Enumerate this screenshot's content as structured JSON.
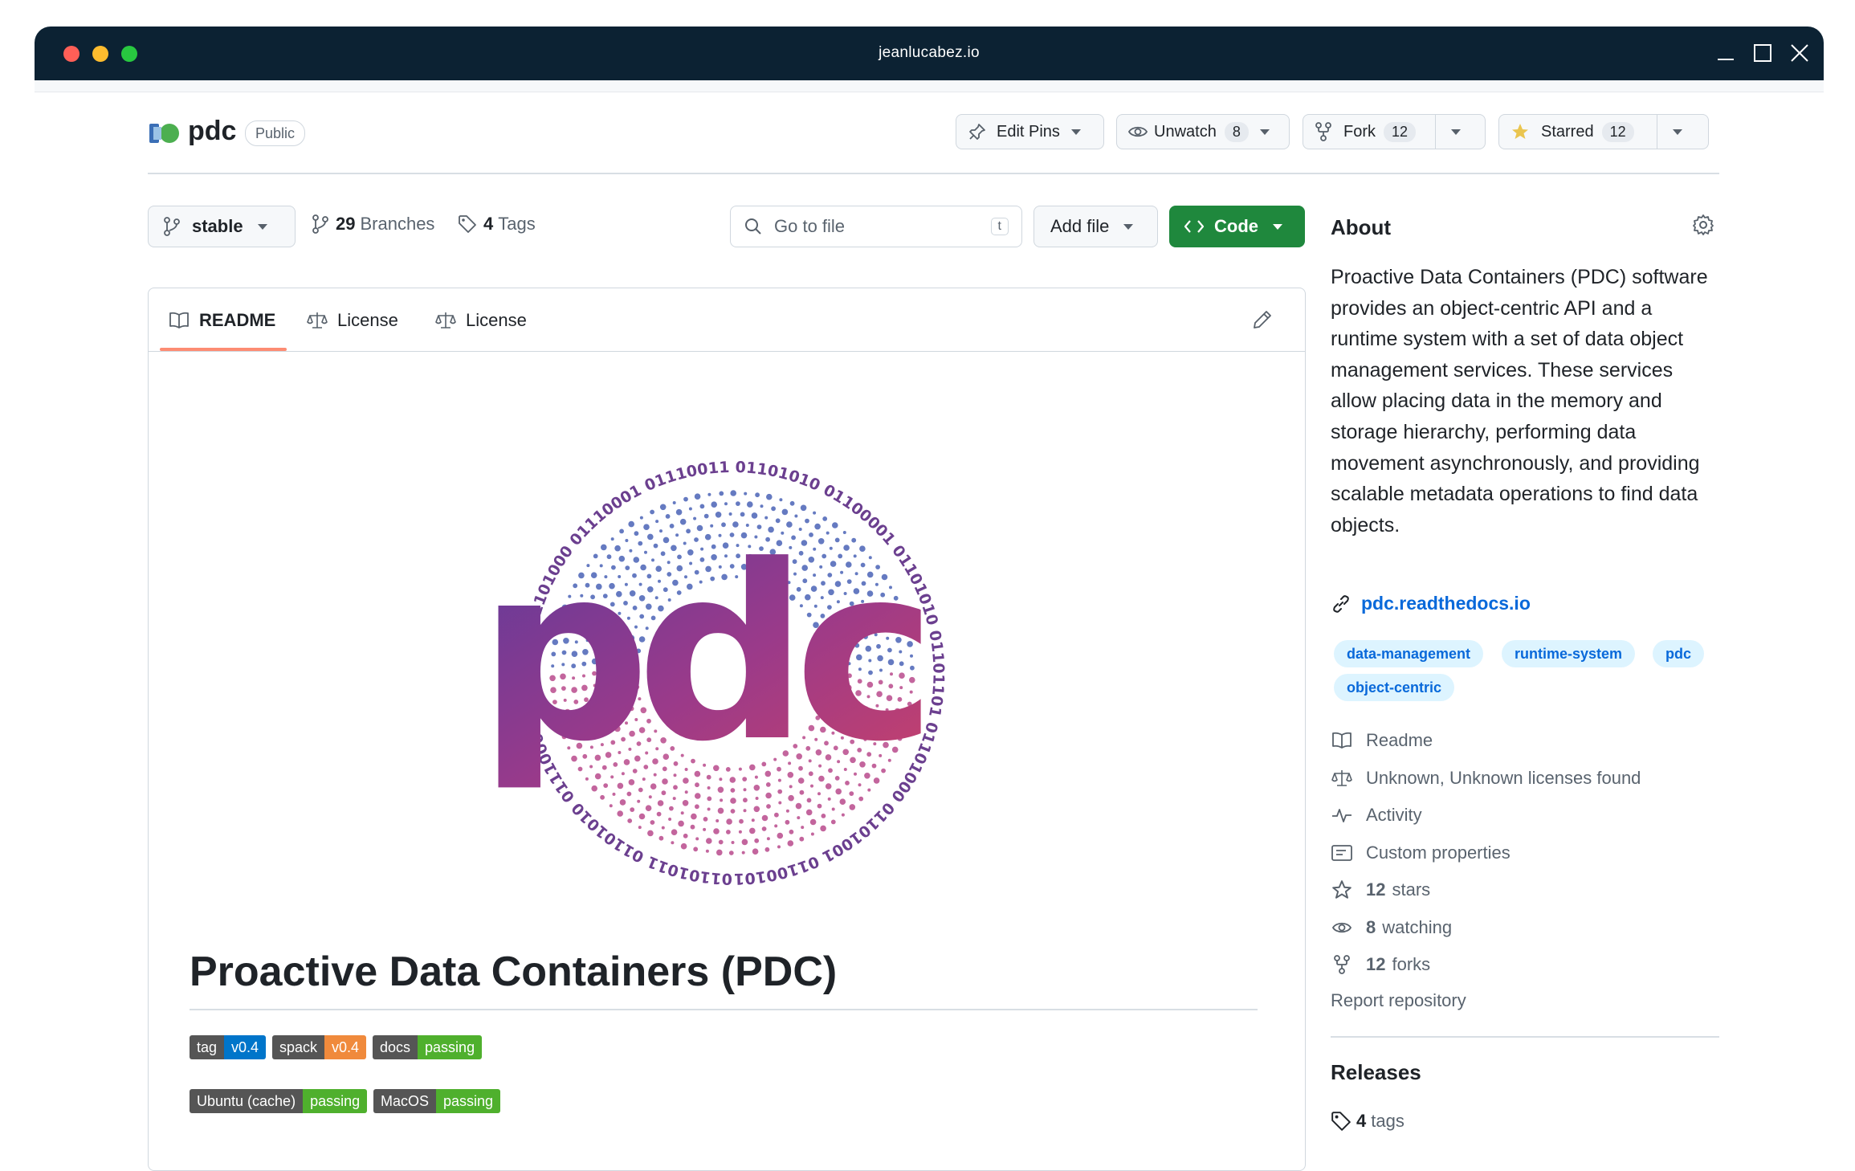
{
  "window": {
    "title": "jeanlucabez.io"
  },
  "repo": {
    "name": "pdc",
    "visibility": "Public"
  },
  "actions": {
    "edit_pins": "Edit Pins",
    "unwatch": "Unwatch",
    "unwatch_count": "8",
    "fork": "Fork",
    "fork_count": "12",
    "starred": "Starred",
    "star_count": "12"
  },
  "toolbar": {
    "branch": "stable",
    "branches_count": "29",
    "branches_label": "Branches",
    "tags_count": "4",
    "tags_label": "Tags",
    "search_placeholder": "Go to file",
    "search_key": "t",
    "add_file": "Add file",
    "code": "Code"
  },
  "readme_tabs": [
    "README",
    "License",
    "License"
  ],
  "readme": {
    "logo_text": "pdc",
    "binary_ring": [
      "01101011",
      "01101010",
      "01110001",
      "01101010",
      "01101000",
      "01110001",
      "01110011",
      "01101010",
      "01100001",
      "01101010",
      "01101101",
      "01101000",
      "01101001",
      "01100101"
    ],
    "heading": "Proactive Data Containers (PDC)",
    "badges_row1": [
      {
        "label": "tag",
        "value": "v0.4",
        "color": "#0075ca"
      },
      {
        "label": "spack",
        "value": "v0.4",
        "color": "#f08a3c"
      },
      {
        "label": "docs",
        "value": "passing",
        "color": "#4fb02d"
      }
    ],
    "badges_row2": [
      {
        "label": "Ubuntu (cache)",
        "value": "passing",
        "color": "#4fb02d"
      },
      {
        "label": "MacOS",
        "value": "passing",
        "color": "#4fb02d"
      }
    ]
  },
  "about": {
    "title": "About",
    "description": "Proactive Data Containers (PDC) software provides an object-centric API and a runtime system with a set of data object management services. These services allow placing data in the memory and storage hierarchy, performing data movement asynchronously, and providing scalable metadata operations to find data objects.",
    "link": "pdc.readthedocs.io",
    "topics": [
      "data-management",
      "runtime-system",
      "pdc",
      "object-centric"
    ],
    "items": {
      "readme": "Readme",
      "license": "Unknown, Unknown licenses found",
      "activity": "Activity",
      "custom": "Custom properties",
      "stars_count": "12",
      "stars_label": "stars",
      "watching_count": "8",
      "watching_label": "watching",
      "forks_count": "12",
      "forks_label": "forks"
    },
    "report": "Report repository"
  },
  "releases": {
    "title": "Releases",
    "tags_count": "4",
    "tags_label": "tags"
  },
  "colors": {
    "accent": "#0969da",
    "code_button": "#1f883d",
    "titlebar": "#0c2233",
    "tab_underline": "#fd8c73",
    "logo_purple": "#6b3fa0",
    "logo_magenta": "#c13a6e"
  }
}
